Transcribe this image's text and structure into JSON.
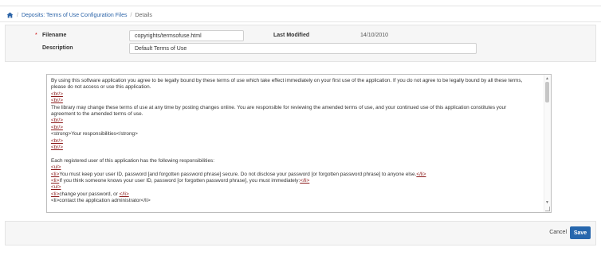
{
  "breadcrumb": {
    "home_icon": "home-icon",
    "separator": "/",
    "parent": "Deposits: Terms of Use Configuration Files",
    "current": "Details"
  },
  "form": {
    "filename_required_mark": "*",
    "filename_label": "Filename",
    "filename_value": "copyrights/termsofuse.html",
    "last_modified_label": "Last Modified",
    "last_modified_value": "14/10/2010",
    "description_label": "Description",
    "description_value": "Default Terms of Use"
  },
  "editor": {
    "lines": [
      {
        "type": "plain",
        "text": "By using this software application you agree to be legally bound by these terms of use which take effect immediately on your first use of the application. If you do not agree to be legally bound by all these terms,"
      },
      {
        "type": "plain",
        "text": "please do not access or use this application."
      },
      {
        "type": "tag",
        "text": "<br/>"
      },
      {
        "type": "tag",
        "text": "<br/>"
      },
      {
        "type": "plain",
        "text": "The library may change these terms of use at any time by posting changes online.  You are responsible for reviewing the amended terms of use, and your continued use of this application constitutes your"
      },
      {
        "type": "plain",
        "text": "agreement to the amended terms of use."
      },
      {
        "type": "tag",
        "text": "<br/>"
      },
      {
        "type": "tag",
        "text": "<br/>"
      },
      {
        "type": "plain",
        "text": "<strong>Your responsibilities</strong>"
      },
      {
        "type": "tag",
        "text": "<br/>"
      },
      {
        "type": "tag",
        "text": "<br/>"
      },
      {
        "type": "blank",
        "text": ""
      },
      {
        "type": "plain",
        "text": "Each registered user of this application has the following responsibilities:"
      },
      {
        "type": "tag",
        "text": "<ul>"
      },
      {
        "type": "mixed",
        "open": "<li>",
        "text": "You must keep your user ID, password [and forgotten password phrase] secure.  Do not disclose your password [or forgotten password phrase] to anyone else.",
        "close": "</li>"
      },
      {
        "type": "mixed",
        "open": "<li>",
        "text": "If you think someone knows your user ID, password [or forgotten password phrase], you must immediately:",
        "close": "</li>"
      },
      {
        "type": "tag",
        "text": "<ul>"
      },
      {
        "type": "mixed",
        "open": "<li>",
        "text": "change your password, or ",
        "close": "</li>"
      },
      {
        "type": "plain",
        "text": "<li>contact the application administrator</li>"
      }
    ]
  },
  "footer": {
    "cancel_label": "Cancel",
    "save_label": "Save"
  }
}
